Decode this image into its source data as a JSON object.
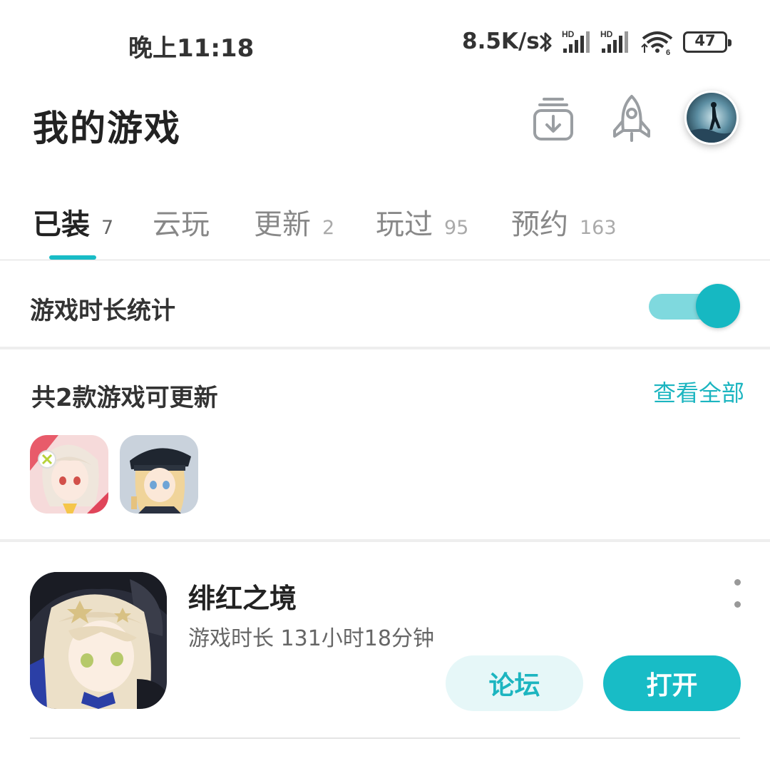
{
  "status_bar": {
    "time": "晚上11:18",
    "network_speed": "8.5K/s",
    "battery": "47",
    "icons": [
      "bluetooth-icon",
      "signal-hd-icon",
      "signal-hd-icon",
      "wifi-6-icon",
      "battery-icon"
    ]
  },
  "header": {
    "title": "我的游戏",
    "icons": [
      "download-manager-icon",
      "rocket-icon",
      "avatar"
    ]
  },
  "tabs": [
    {
      "label": "已装",
      "count": "7",
      "active": true
    },
    {
      "label": "云玩",
      "count": "",
      "active": false
    },
    {
      "label": "更新",
      "count": "2",
      "active": false
    },
    {
      "label": "玩过",
      "count": "95",
      "active": false
    },
    {
      "label": "预约",
      "count": "163",
      "active": false
    }
  ],
  "playtime_toggle": {
    "label": "游戏时长统计",
    "enabled": true
  },
  "updates": {
    "title": "共2款游戏可更新",
    "view_all": "查看全部"
  },
  "game": {
    "name": "绯红之境",
    "playtime": "游戏时长 131小时18分钟",
    "forum_label": "论坛",
    "open_label": "打开"
  },
  "colors": {
    "accent": "#18bcc6",
    "accent_light": "#e6f7f8",
    "toggle_track": "#7fd9de"
  }
}
